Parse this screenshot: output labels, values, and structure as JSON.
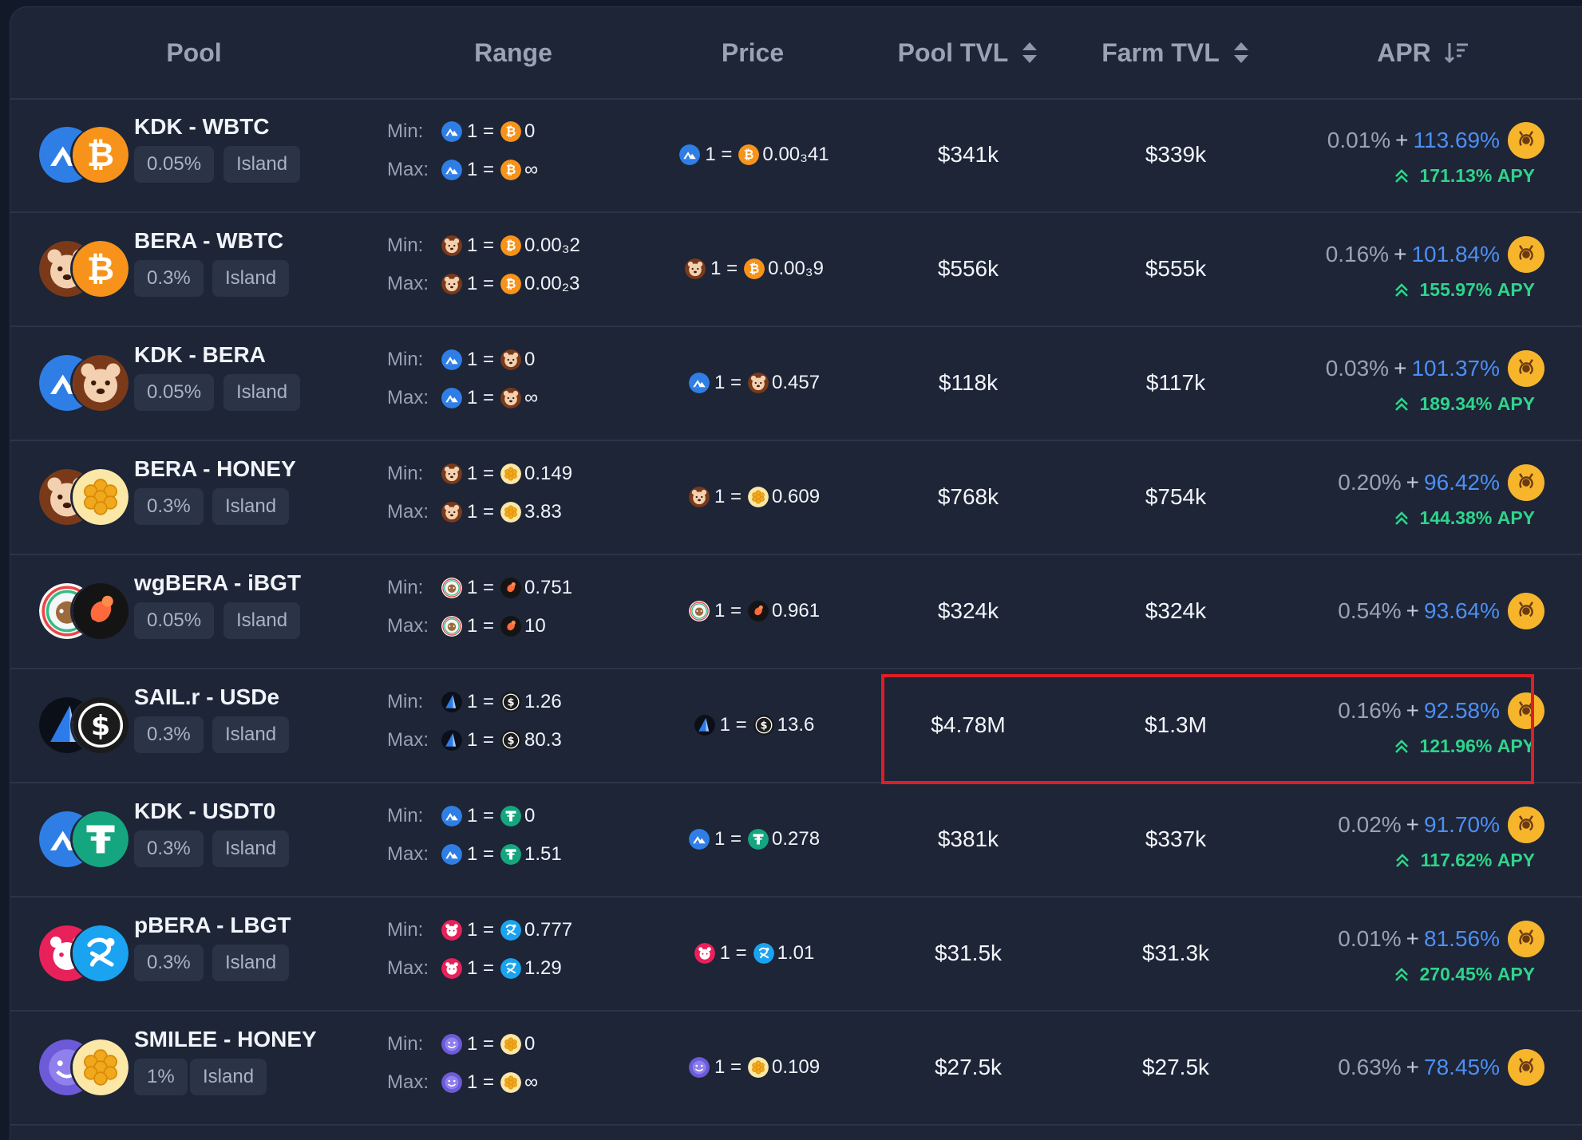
{
  "header": {
    "pool": "Pool",
    "range": "Range",
    "price": "Price",
    "pool_tvl": "Pool TVL",
    "farm_tvl": "Farm TVL",
    "apr": "APR"
  },
  "labels": {
    "min": "Min:",
    "max": "Max:",
    "one_eq": "1 =",
    "apy_suffix": "APY"
  },
  "colors": {
    "kdk": "#2f7ee6",
    "btc": "#f7931a",
    "bera": "#7a3a1a",
    "honey": "#f2b531",
    "igbt": "#1a1a1a",
    "sail": "#0b0f18",
    "usde": "#1b1b1b",
    "usdt0": "#15a67f",
    "pbera": "#e8215a",
    "lbgt": "#1aa3f0",
    "smilee": "#6d5ad8",
    "wgbera": "#f4f4f4",
    "accent_green": "#2fd48a",
    "accent_blue": "#4d8ff5",
    "highlight": "#e01d24"
  },
  "rows": [
    {
      "name": "KDK - WBTC",
      "fee": "0.05%",
      "type": "Island",
      "min_val": "0",
      "max_val": "∞",
      "price": "0.00₃41",
      "pool_tvl": "$341k",
      "farm_tvl": "$339k",
      "base_apr": "0.01%",
      "boost_apr": "113.69%",
      "apy": "171.13%",
      "t1": "kdk",
      "t2": "btc"
    },
    {
      "name": "BERA - WBTC",
      "fee": "0.3%",
      "type": "Island",
      "min_val": "0.00₃2",
      "max_val": "0.00₂3",
      "price": "0.00₃9",
      "pool_tvl": "$556k",
      "farm_tvl": "$555k",
      "base_apr": "0.16%",
      "boost_apr": "101.84%",
      "apy": "155.97%",
      "t1": "bera",
      "t2": "btc"
    },
    {
      "name": "KDK - BERA",
      "fee": "0.05%",
      "type": "Island",
      "min_val": "0",
      "max_val": "∞",
      "price": "0.457",
      "pool_tvl": "$118k",
      "farm_tvl": "$117k",
      "base_apr": "0.03%",
      "boost_apr": "101.37%",
      "apy": "189.34%",
      "t1": "kdk",
      "t2": "bera"
    },
    {
      "name": "BERA - HONEY",
      "fee": "0.3%",
      "type": "Island",
      "min_val": "0.149",
      "max_val": "3.83",
      "price": "0.609",
      "pool_tvl": "$768k",
      "farm_tvl": "$754k",
      "base_apr": "0.20%",
      "boost_apr": "96.42%",
      "apy": "144.38%",
      "t1": "bera",
      "t2": "honey"
    },
    {
      "name": "wgBERA - iBGT",
      "fee": "0.05%",
      "type": "Island",
      "min_val": "0.751",
      "max_val": "10",
      "price": "0.961",
      "pool_tvl": "$324k",
      "farm_tvl": "$324k",
      "base_apr": "0.54%",
      "boost_apr": "93.64%",
      "apy": "",
      "t1": "wgbera",
      "t2": "igbt"
    },
    {
      "name": "SAIL.r - USDe",
      "fee": "0.3%",
      "type": "Island",
      "min_val": "1.26",
      "max_val": "80.3",
      "price": "13.6",
      "pool_tvl": "$4.78M",
      "farm_tvl": "$1.3M",
      "base_apr": "0.16%",
      "boost_apr": "92.58%",
      "apy": "121.96%",
      "t1": "sail",
      "t2": "usde"
    },
    {
      "name": "KDK - USDT0",
      "fee": "0.3%",
      "type": "Island",
      "min_val": "0",
      "max_val": "1.51",
      "price": "0.278",
      "pool_tvl": "$381k",
      "farm_tvl": "$337k",
      "base_apr": "0.02%",
      "boost_apr": "91.70%",
      "apy": "117.62%",
      "t1": "kdk",
      "t2": "usdt0"
    },
    {
      "name": "pBERA - LBGT",
      "fee": "0.3%",
      "type": "Island",
      "min_val": "0.777",
      "max_val": "1.29",
      "price": "1.01",
      "pool_tvl": "$31.5k",
      "farm_tvl": "$31.3k",
      "base_apr": "0.01%",
      "boost_apr": "81.56%",
      "apy": "270.45%",
      "t1": "pbera",
      "t2": "lbgt"
    },
    {
      "name": "SMILEE - HONEY",
      "fee": "1%",
      "type": "Island",
      "min_val": "0",
      "max_val": "∞",
      "price": "0.109",
      "pool_tvl": "$27.5k",
      "farm_tvl": "$27.5k",
      "base_apr": "0.63%",
      "boost_apr": "78.45%",
      "apy": "",
      "t1": "smilee",
      "t2": "honey"
    }
  ]
}
